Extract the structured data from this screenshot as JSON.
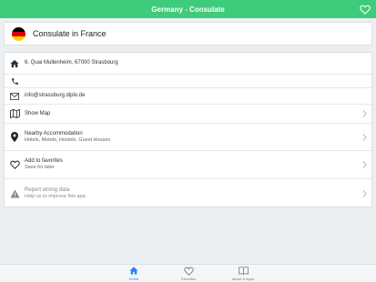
{
  "app": {
    "title": "Germany - Consulate"
  },
  "header": {
    "title": "Consulate in France",
    "flag_colors": [
      "#000000",
      "#dd0000",
      "#ffce00"
    ]
  },
  "colors": {
    "accent": "#3ecb7b",
    "tab_active": "#2d7ff9"
  },
  "details": [
    {
      "icon": "home-icon",
      "line1": "6, Quai Mullenheim, 67000 Strasbourg",
      "line2": "",
      "chevron": false
    },
    {
      "icon": "phone-icon",
      "line1": "",
      "line2": "",
      "chevron": false
    },
    {
      "icon": "mail-icon",
      "line1": "info@strassburg.diplo.de",
      "line2": "",
      "chevron": false
    },
    {
      "icon": "map-icon",
      "line1": "Show Map",
      "line2": "",
      "chevron": true
    },
    {
      "icon": "location-pin-icon",
      "line1": "Nearby Accommodation",
      "line2": "Hotels, Motels, Hostels, Guest Houses",
      "chevron": true
    },
    {
      "icon": "heart-outline-icon",
      "line1": "Add to favorites",
      "line2": "Save for later",
      "chevron": true
    },
    {
      "icon": "warning-icon",
      "line1": "Report wrong data",
      "line2": "Help us to improve this app.",
      "chevron": true
    }
  ],
  "tabs": [
    {
      "label": "Home",
      "icon": "home-tab-icon",
      "active": true
    },
    {
      "label": "Favorites",
      "icon": "heart-tab-icon",
      "active": false
    },
    {
      "label": "About & Apps",
      "icon": "book-tab-icon",
      "active": false
    }
  ]
}
